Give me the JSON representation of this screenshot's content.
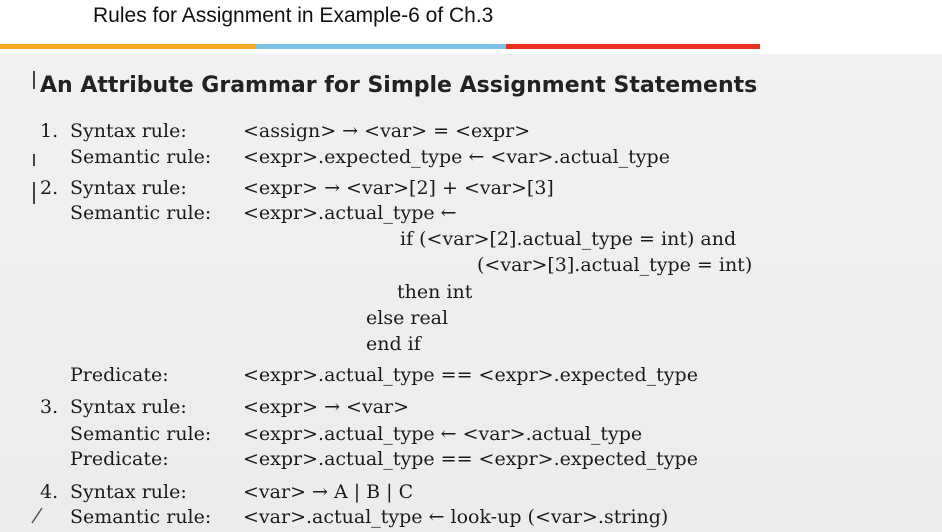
{
  "header": {
    "title": "Rules for Assignment in Example-6 of Ch.3",
    "accent_colors": [
      "#f5a623",
      "#7cc1e8",
      "#e8321e"
    ]
  },
  "document": {
    "title": "An Attribute Grammar for Simple Assignment Statements",
    "rules": [
      {
        "number": "1.",
        "syntax_label": "Syntax rule:",
        "syntax": "<assign> → <var> = <expr>",
        "semantic_label": "Semantic rule:",
        "semantic": "<expr>.expected_type ← <var>.actual_type"
      },
      {
        "number": "2.",
        "syntax_label": "Syntax rule:",
        "syntax": "<expr> → <var>[2] + <var>[3]",
        "semantic_label": "Semantic rule:",
        "semantic": "<expr>.actual_type ←",
        "semantic_cont": [
          "if (<var>[2].actual_type = int) and",
          "(<var>[3].actual_type = int)",
          "then int",
          "else real",
          "end if"
        ],
        "predicate_label": "Predicate:",
        "predicate": "<expr>.actual_type == <expr>.expected_type"
      },
      {
        "number": "3.",
        "syntax_label": "Syntax rule:",
        "syntax": "<expr> → <var>",
        "semantic_label": "Semantic rule:",
        "semantic": "<expr>.actual_type ← <var>.actual_type",
        "predicate_label": "Predicate:",
        "predicate": "<expr>.actual_type == <expr>.expected_type"
      },
      {
        "number": "4.",
        "syntax_label": "Syntax rule:",
        "syntax": "<var> → A | B | C",
        "semantic_label": "Semantic rule:",
        "semantic": "<var>.actual_type ← look-up (<var>.string)"
      }
    ]
  }
}
